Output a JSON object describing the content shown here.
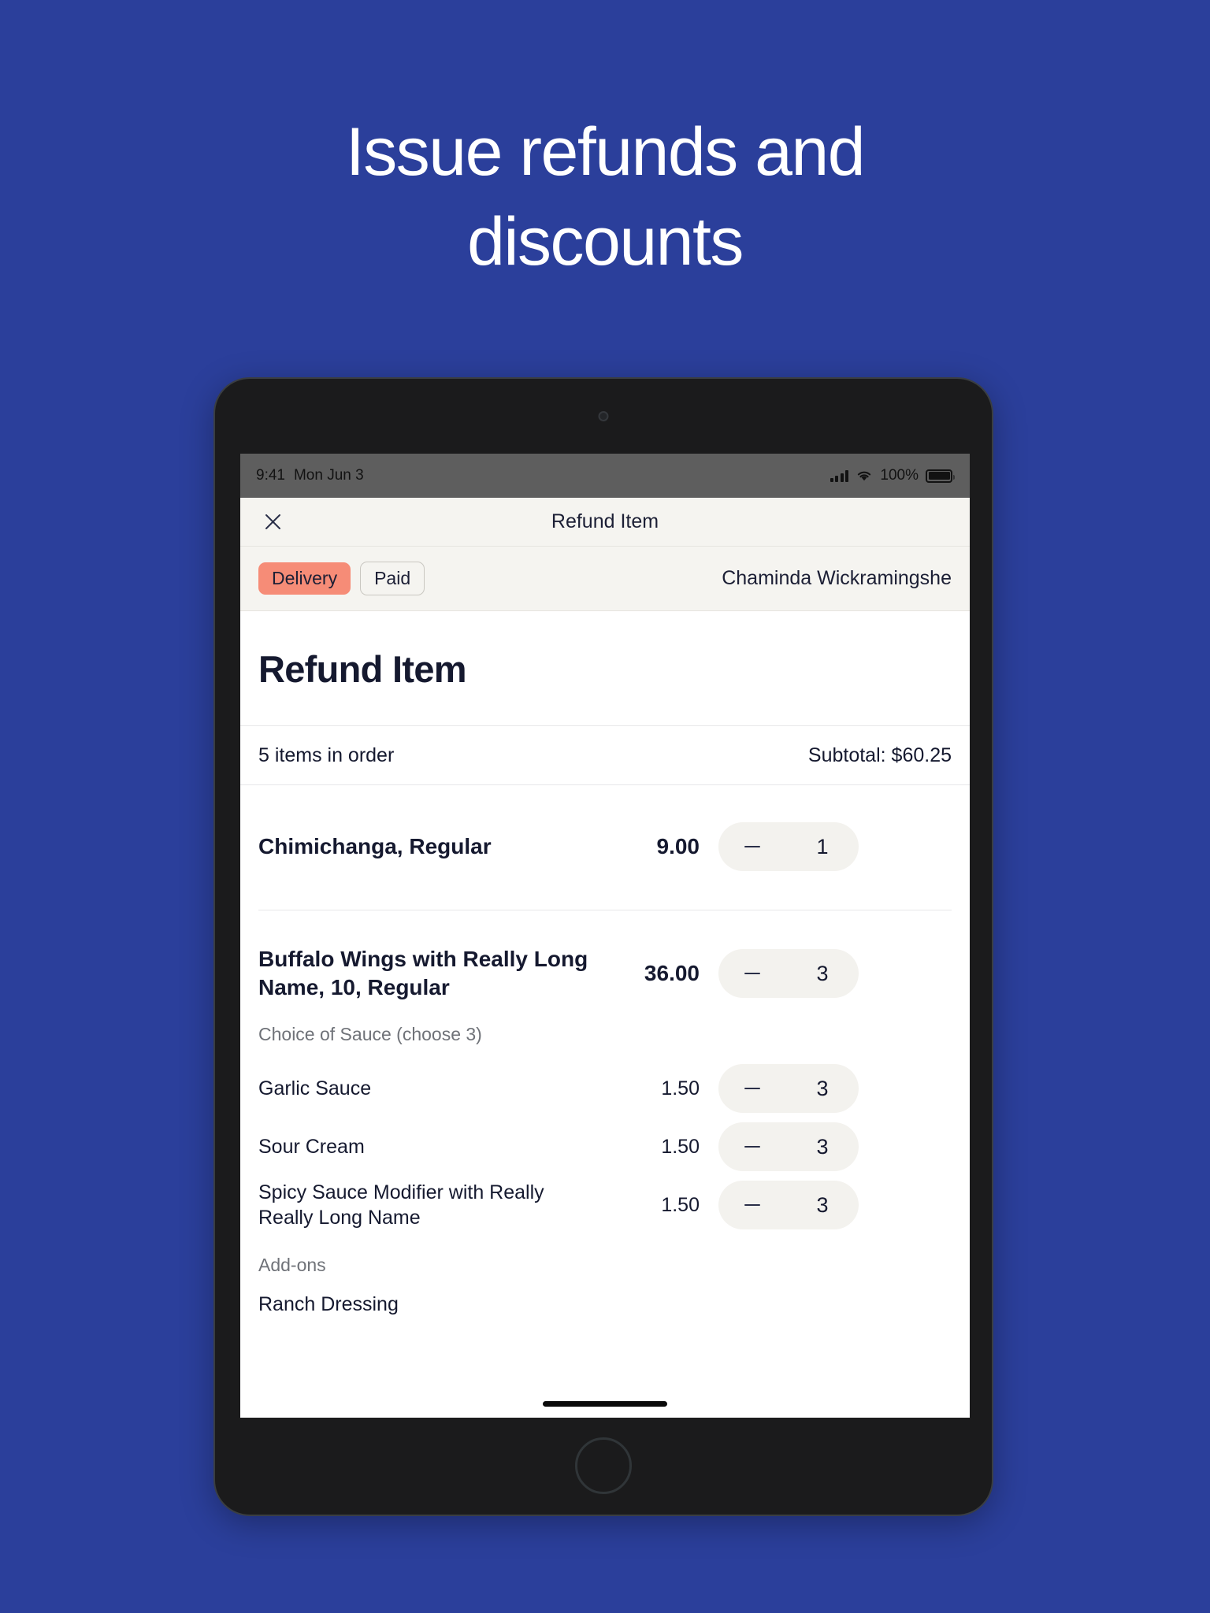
{
  "marketing": {
    "headline_lines": [
      "Issue refunds and",
      "discounts"
    ],
    "background_color": "#2b3f9b",
    "text_color": "#ffffff"
  },
  "status_bar": {
    "time": "9:41",
    "date": "Mon Jun 3",
    "battery_percent": "100%",
    "signal_icon": "cellular-signal-icon",
    "wifi_icon": "wifi-icon",
    "battery_icon": "battery-icon"
  },
  "sheet": {
    "close_icon": "close-icon",
    "header_title": "Refund Item",
    "badges": [
      {
        "label": "Delivery",
        "style": "filled",
        "color": "#f68c77"
      },
      {
        "label": "Paid",
        "style": "outline"
      }
    ],
    "customer_name": "Chaminda Wickramingshe",
    "page_title": "Refund Item",
    "summary": {
      "item_count_label": "5 items in order",
      "subtotal_label": "Subtotal: $60.25"
    },
    "items": [
      {
        "name": "Chimichanga, Regular",
        "price": "9.00",
        "qty": "1",
        "type": "primary"
      },
      {
        "name": "Buffalo Wings with Really Long Name, 10, Regular",
        "price": "36.00",
        "qty": "3",
        "type": "primary"
      }
    ],
    "sauce_group": {
      "label": "Choice of Sauce (choose 3)",
      "modifiers": [
        {
          "name": "Garlic Sauce",
          "price": "1.50",
          "qty": "3"
        },
        {
          "name": "Sour Cream",
          "price": "1.50",
          "qty": "3"
        },
        {
          "name": "Spicy Sauce Modifier with Really Really Long Name",
          "price": "1.50",
          "qty": "3"
        }
      ]
    },
    "addons_group": {
      "label": "Add-ons",
      "items": [
        {
          "name": "Ranch Dressing"
        }
      ]
    }
  }
}
